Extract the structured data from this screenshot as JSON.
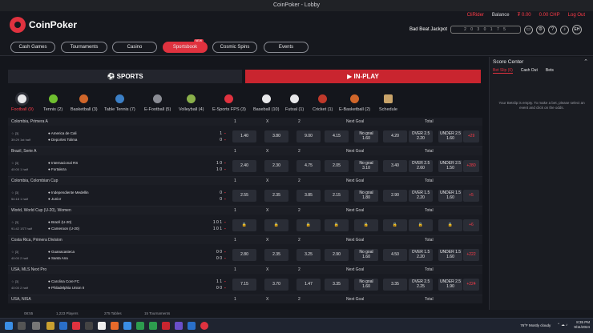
{
  "window": {
    "title": "CoinPoker - Lobby"
  },
  "brand": {
    "name": "CoinPoker",
    "accent": "#e0323f"
  },
  "account": {
    "user": "CliRider",
    "balance_label": "Balance",
    "balance": "₮ 0.00",
    "chp": "0.00 CHP",
    "logout": "Log Out",
    "jackpot_label": "Bad Beat Jackpot",
    "jackpot_value": "2 0 3 0 1 7 5",
    "avatar": "EH"
  },
  "nav": {
    "items": [
      "Cash Games",
      "Tournaments",
      "Casino",
      "Sportsbook",
      "Cosmic Spins",
      "Events"
    ],
    "active": "Sportsbook",
    "badge": "NEW"
  },
  "switch": {
    "sports": "SPORTS",
    "inplay": "IN-PLAY"
  },
  "categories": [
    "Football (9)",
    "Tennis (2)",
    "Basketball (3)",
    "Table Tennis (7)",
    "E-Football (5)",
    "Volleyball (4)",
    "E-Sports FPS (3)",
    "Baseball (10)",
    "Futsal (1)",
    "Cricket (1)",
    "E-Basketball (2)",
    "Schedule"
  ],
  "cols": {
    "one": "1",
    "x": "X",
    "two": "2",
    "next": "Next Goal",
    "total": "Total"
  },
  "leagues": [
    {
      "name": "Colombia, Primera A",
      "meta": [
        "☆ [3]",
        "39:29  1st half"
      ],
      "teams": [
        "America de Cali",
        "Deportes Tolima"
      ],
      "score": [
        "1",
        "0"
      ],
      "odds": [
        "1.40",
        "3.80",
        "9.00"
      ],
      "ng": [
        "4.15",
        "No goal\n1.60",
        "4.20"
      ],
      "tot": [
        "OVER 2.5\n2.20",
        "UNDER 2.5\n1.60"
      ],
      "more": "+29"
    },
    {
      "name": "Brazil, Serie A",
      "meta": [
        "☆ [3]",
        "40:00  1 half"
      ],
      "teams": [
        "Internacional RS",
        "Fortaleza"
      ],
      "score": [
        "1 0",
        "1 0"
      ],
      "odds": [
        "2.40",
        "2.30",
        "4.75"
      ],
      "ng": [
        "2.05",
        "No goal\n3.10",
        "3.40"
      ],
      "tot": [
        "OVER 2.5\n2.60",
        "UNDER 2.5\n1.50"
      ],
      "more": "+280"
    },
    {
      "name": "Colombia, Colombian Cup",
      "meta": [
        "☆ [3]",
        "54:18  1 half"
      ],
      "teams": [
        "Independiente Medellin",
        "Junior"
      ],
      "score": [
        "0",
        "0"
      ],
      "odds": [
        "2.55",
        "2.35",
        "3.85"
      ],
      "ng": [
        "2.15",
        "No goal\n1.80",
        "2.90"
      ],
      "tot": [
        "OVER 1.5\n2.20",
        "UNDER 1.5\n1.60"
      ],
      "more": "+5"
    },
    {
      "name": "World, World Cup (U-20), Women",
      "meta": [
        "☆ [3]",
        "91:42  1ST half"
      ],
      "teams": [
        "Brazil (U-20)",
        "Cameroon (U-20)"
      ],
      "score": [
        "1 0 1",
        "1 0 1"
      ],
      "odds": [
        "🔒",
        "🔒",
        "🔒"
      ],
      "ng": [
        "🔒",
        "🔒",
        "🔒"
      ],
      "tot": [
        "🔒",
        "🔒"
      ],
      "more": "+6"
    },
    {
      "name": "Costa Rica, Primera Division",
      "meta": [
        "☆ [3]",
        "40:00  2 half"
      ],
      "teams": [
        "Guanacasteca",
        "Santa Ana"
      ],
      "score": [
        "0 0",
        "0 0"
      ],
      "odds": [
        "2.80",
        "2.35",
        "3.25"
      ],
      "ng": [
        "2.90",
        "No goal\n1.60",
        "4.50"
      ],
      "tot": [
        "OVER 1.5\n2.20",
        "UNDER 1.5\n1.60"
      ],
      "more": "+222"
    },
    {
      "name": "USA, MLS Next Pro",
      "meta": [
        "☆ [3]",
        "40:00  2 half"
      ],
      "teams": [
        "Carolina Core FC",
        "Philadelphia Union II"
      ],
      "score": [
        "1 1",
        "0 0"
      ],
      "odds": [
        "7.15",
        "3.70",
        "1.47"
      ],
      "ng": [
        "3.35",
        "No goal\n1.60",
        "3.35"
      ],
      "tot": [
        "OVER 2.5\n2.25",
        "UNDER 2.5\n1.90"
      ],
      "more": "+224"
    },
    {
      "name": "USA, NISA",
      "meta": [
        "",
        ""
      ],
      "teams": [
        "",
        ""
      ],
      "score": [
        "",
        ""
      ],
      "odds": [
        "",
        "",
        ""
      ],
      "ng": [
        "",
        "",
        ""
      ],
      "tot": [
        "",
        ""
      ],
      "more": ""
    }
  ],
  "score_center": {
    "title": "Score Center",
    "tabs": [
      "Bet Slip (0)",
      "Cash Out",
      "Bets"
    ],
    "message": "Your Betslip is empty. To make a bet, please select an event and click on the odds."
  },
  "status": {
    "time": "08:55",
    "players": "1,223 Players",
    "tables": "275 Tables",
    "tournaments": "15 Tournaments"
  },
  "taskbar": {
    "weather": "76°F  Mostly cloudy",
    "clock": [
      "8:35 PM",
      "9/11/2024"
    ]
  }
}
